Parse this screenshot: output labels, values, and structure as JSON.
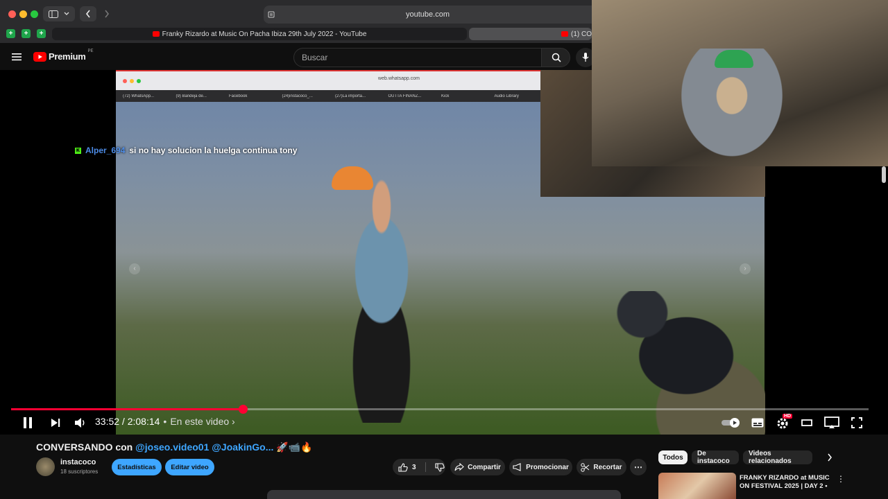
{
  "browser": {
    "address": "youtube.com",
    "active_tab": "Franky Rizardo at Music On Pacha Ibiza 29th July 2022 - YouTube",
    "other_tab": "(1) CO"
  },
  "youtube": {
    "logo_label": "Premium",
    "region": "PE",
    "search_placeholder": "Buscar"
  },
  "video_overlay": {
    "inner_address": "web.whatsapp.com",
    "inner_tabs": [
      "(72) WhatsApp...",
      "(9) Bandeja de...",
      "Facebook",
      "(24)instacoco_...",
      "(27)La importa...",
      "OUTTA FINANZ...",
      "Kick",
      "Audio Library"
    ],
    "chat_user": "Alper_694",
    "chat_message": "si no hay solucion la huelga continua tony"
  },
  "player": {
    "progress": 0.27,
    "time": "33:52 / 2:08:14",
    "separator": "•",
    "chapter_label": "En este video",
    "hd_badge": "HD"
  },
  "video_info": {
    "title_prefix": "CONVERSANDO con ",
    "title_mentions": "@joseo.video01 @JoakinGo...",
    "title_suffix": " 🚀📹🔥",
    "channel_name": "instacoco",
    "subscribers": "18 suscriptores",
    "stats_button": "Estadísticas",
    "edit_button": "Editar video",
    "like_count": "3",
    "share_button": "Compartir",
    "promote_button": "Promocionar",
    "clip_button": "Recortar"
  },
  "sidebar": {
    "chips": [
      "Todos",
      "De instacoco",
      "Videos relacionados"
    ],
    "related_title": "FRANKY RIZARDO at MUSIC ON FESTIVAL 2025 | DAY 2 •"
  },
  "colors": {
    "accent": "#ff0033",
    "blue": "#3ea6ff",
    "kick": "#53fc18"
  }
}
